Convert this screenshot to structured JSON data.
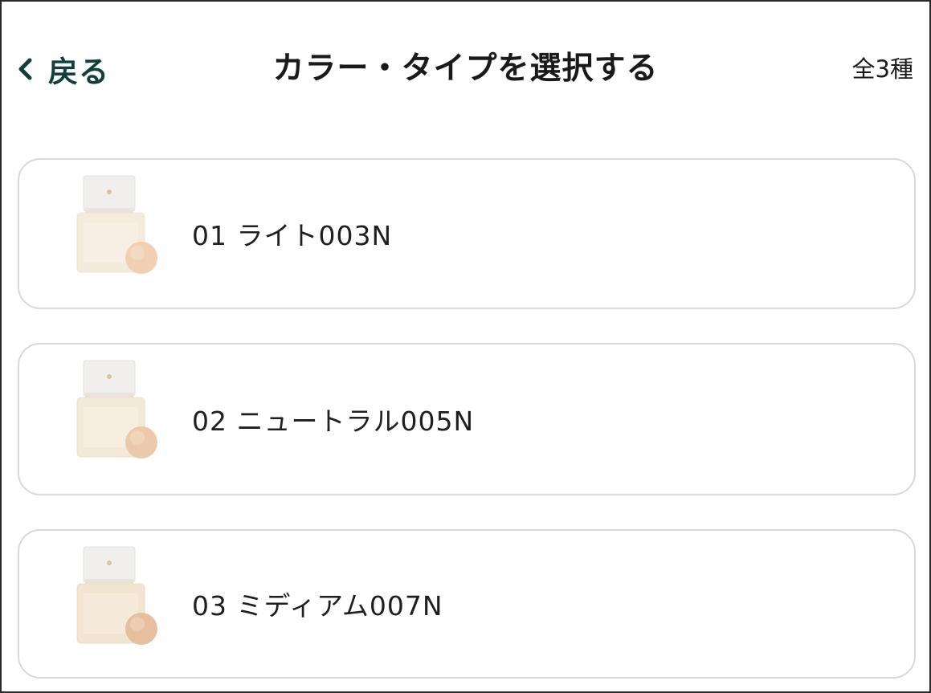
{
  "header": {
    "back_label": "戻る",
    "title": "カラー・タイプを選択する",
    "count": "全3種"
  },
  "items": [
    {
      "label": "01 ライト003N"
    },
    {
      "label": "02 ニュートラル005N"
    },
    {
      "label": "03 ミディアム007N"
    }
  ],
  "icons": {
    "back": "chevron-left-icon",
    "thumbnail": "product-thumbnail"
  },
  "colors": {
    "back_text": "#123f3c",
    "title_text": "#1a1a1a",
    "card_border": "#d9d9d9",
    "frame_border": "#2a2a2a"
  }
}
